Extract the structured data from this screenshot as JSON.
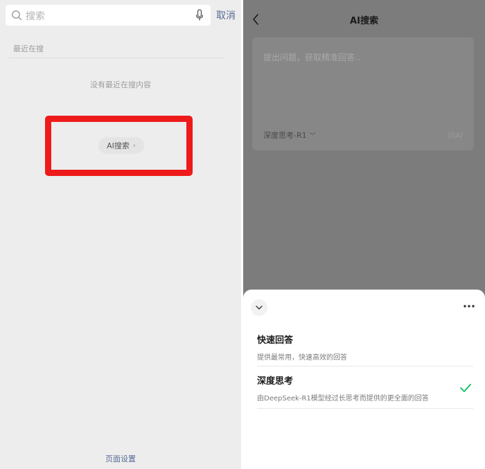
{
  "left": {
    "search": {
      "placeholder": "搜索",
      "cancel_label": "取消"
    },
    "recent": {
      "title": "最近在搜",
      "empty_text": "没有最近在搜内容"
    },
    "ai_search_chip": {
      "label": "AI搜索",
      "chevron": "›"
    },
    "footer": {
      "page_settings_label": "页面设置"
    },
    "colors": {
      "link": "#576b95",
      "highlight": "#ee1b1b"
    }
  },
  "right": {
    "header": {
      "title": "AI搜索"
    },
    "question": {
      "placeholder": "提出问题，获取精准回答..",
      "mode_label": "深度思考-R1",
      "mode_caret": "﹀",
      "ask_label": "问AI"
    },
    "sheet": {
      "options": [
        {
          "title": "快速回答",
          "desc": "提供最常用，快速高效的回答",
          "selected": false
        },
        {
          "title": "深度思考",
          "desc": "由DeepSeek-R1模型经过长思考而提供的更全面的回答",
          "selected": true
        }
      ]
    },
    "colors": {
      "check": "#07c160"
    }
  },
  "icons": [
    "search-icon",
    "mic-icon",
    "back-icon",
    "chevron-down-icon",
    "more-icon",
    "check-icon"
  ]
}
